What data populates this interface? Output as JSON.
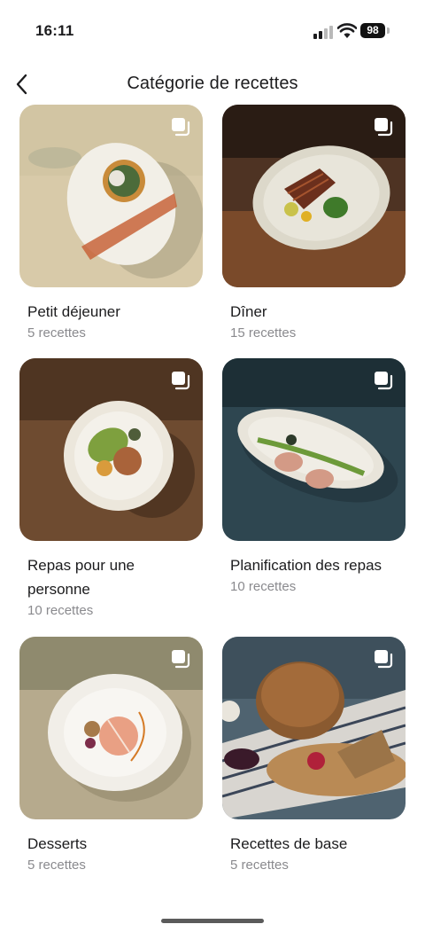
{
  "status_bar": {
    "time": "16:11",
    "battery": "98"
  },
  "header": {
    "title": "Catégorie de recettes",
    "back_icon": "chevron-left-icon"
  },
  "categories": [
    {
      "title": "Petit déjeuner",
      "count": "5 recettes",
      "background": "#d9ccae",
      "plate": "#f1eee6"
    },
    {
      "title": "Dîner",
      "count": "15 recettes",
      "background": "#5a3a26",
      "plate": "#e6e2d5"
    },
    {
      "title": "Repas pour une personne",
      "count": "10 recettes",
      "background": "#6b4c34",
      "plate": "#ece7dc"
    },
    {
      "title": "Planification des repas",
      "count": "10 recettes",
      "background": "#2f4650",
      "plate": "#eae6dc"
    },
    {
      "title": "Desserts",
      "count": "5 recettes",
      "background": "#b7ab8e",
      "plate": "#f4f1ec"
    },
    {
      "title": "Recettes de base",
      "count": "5 recettes",
      "background": "#4a5b66",
      "plate": "#b98a55"
    }
  ],
  "colors": {
    "text_primary": "#1c1c1e",
    "text_secondary": "#8a8a8e",
    "background": "#ffffff"
  }
}
